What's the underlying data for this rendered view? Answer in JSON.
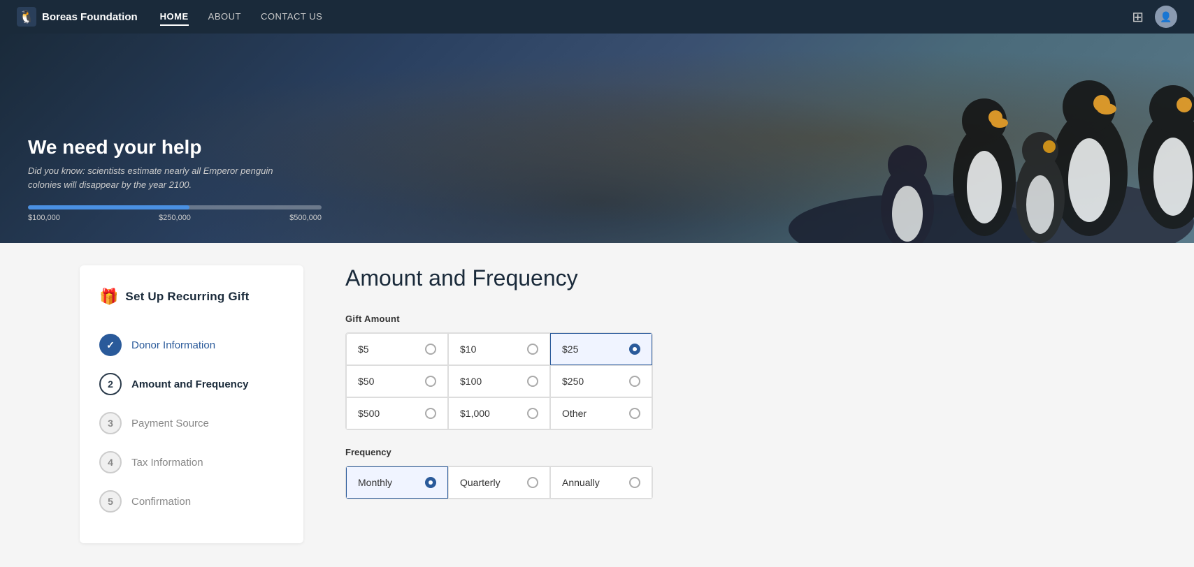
{
  "nav": {
    "logo_text": "Boreas Foundation",
    "links": [
      {
        "label": "HOME",
        "active": true
      },
      {
        "label": "ABOUT",
        "active": false
      },
      {
        "label": "CONTACT US",
        "active": false
      }
    ]
  },
  "hero": {
    "title": "We need your help",
    "subtitle": "Did you know: scientists estimate nearly all Emperor penguin colonies will disappear by the year 2100.",
    "progress_fill_pct": "55%",
    "progress_labels": [
      "$100,000",
      "$250,000",
      "$500,000"
    ]
  },
  "stepper": {
    "heading": "Set Up Recurring Gift",
    "steps": [
      {
        "number": "✓",
        "label": "Donor Information",
        "state": "completed"
      },
      {
        "number": "2",
        "label": "Amount and Frequency",
        "state": "active"
      },
      {
        "number": "3",
        "label": "Payment Source",
        "state": "inactive"
      },
      {
        "number": "4",
        "label": "Tax Information",
        "state": "inactive"
      },
      {
        "number": "5",
        "label": "Confirmation",
        "state": "inactive"
      }
    ]
  },
  "form": {
    "title": "Amount and Frequency",
    "gift_amount_label": "Gift Amount",
    "amounts": [
      {
        "value": "$5",
        "selected": false
      },
      {
        "value": "$10",
        "selected": false
      },
      {
        "value": "$25",
        "selected": true
      },
      {
        "value": "$50",
        "selected": false
      },
      {
        "value": "$100",
        "selected": false
      },
      {
        "value": "$250",
        "selected": false
      },
      {
        "value": "$500",
        "selected": false
      },
      {
        "value": "$1,000",
        "selected": false
      },
      {
        "value": "Other",
        "selected": false
      }
    ],
    "frequency_label": "Frequency",
    "frequencies": [
      {
        "value": "Monthly",
        "selected": true
      },
      {
        "value": "Quarterly",
        "selected": false
      },
      {
        "value": "Annually",
        "selected": false
      }
    ]
  }
}
